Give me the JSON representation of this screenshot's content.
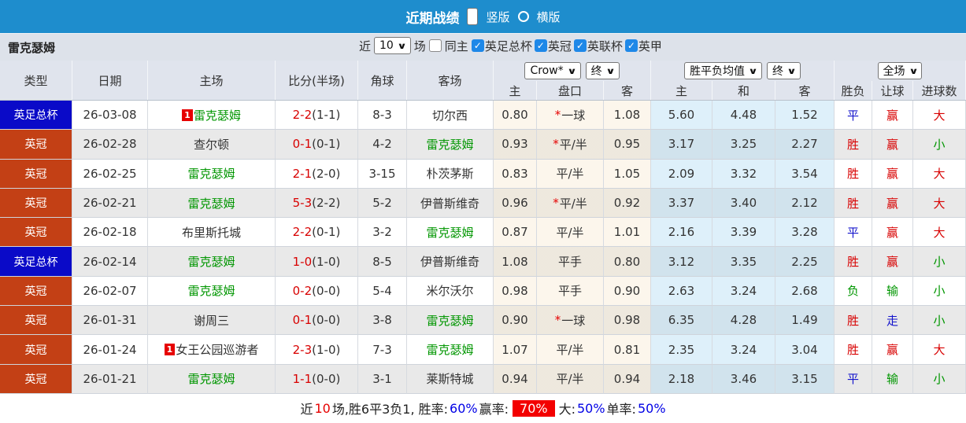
{
  "topbar": {
    "title": "近期战绩",
    "vertical_label": "竖版",
    "horizontal_label": "横版",
    "selected_layout": "竖版"
  },
  "filterbar": {
    "team": "雷克瑟姆",
    "recent_label": "近",
    "recent_value": "10",
    "games_label": "场",
    "same_venue_label": "同主",
    "leagues": [
      {
        "label": "英足总杯",
        "checked": true
      },
      {
        "label": "英冠",
        "checked": true
      },
      {
        "label": "英联杯",
        "checked": true
      },
      {
        "label": "英甲",
        "checked": true
      }
    ]
  },
  "header": {
    "columns": {
      "type": "类型",
      "date": "日期",
      "home": "主场",
      "score": "比分(半场)",
      "corner": "角球",
      "away": "客场",
      "odds_home": "主",
      "odds_line": "盘口",
      "odds_away": "客",
      "avg_home": "主",
      "avg_draw": "和",
      "avg_away": "客",
      "res_wdl": "胜负",
      "res_handicap": "让球",
      "res_goals": "进球数"
    },
    "selects": {
      "bookmaker": "Crow*",
      "odds_time": "终",
      "avg_name": "胜平负均值",
      "avg_time": "终",
      "scope": "全场"
    }
  },
  "colors": {
    "bar_blue": "#1e8dcd",
    "cup_blue": "#0a0ac8",
    "league_orange": "#c34015",
    "team_green": "#009600",
    "score_red": "#d80000",
    "win_red": "#d80000",
    "draw_blue": "#1414cc",
    "lose_green": "#009600",
    "badge_red": "#e60000"
  },
  "rows": [
    {
      "type": "英足总杯",
      "type_style": "cup",
      "date": "26-03-08",
      "home": {
        "badge": "1",
        "name": "雷克瑟姆",
        "green": true
      },
      "score": "2-2",
      "half": "(1-1)",
      "corner": "8-3",
      "away": {
        "name": "切尔西",
        "green": false
      },
      "odds": {
        "home": "0.80",
        "star": true,
        "line": "一球",
        "away": "1.08"
      },
      "avg": {
        "home": "5.60",
        "draw": "4.48",
        "away": "1.52"
      },
      "result": {
        "wdl": "平",
        "wdl_c": "blue",
        "handicap": "赢",
        "handicap_c": "red",
        "goals": "大",
        "goals_c": "red"
      }
    },
    {
      "type": "英冠",
      "type_style": "league",
      "date": "26-02-28",
      "home": {
        "name": "查尔顿",
        "green": false
      },
      "score": "0-1",
      "half": "(0-1)",
      "corner": "4-2",
      "away": {
        "name": "雷克瑟姆",
        "green": true
      },
      "odds": {
        "home": "0.93",
        "star": true,
        "line": "平/半",
        "away": "0.95"
      },
      "avg": {
        "home": "3.17",
        "draw": "3.25",
        "away": "2.27"
      },
      "result": {
        "wdl": "胜",
        "wdl_c": "red",
        "handicap": "赢",
        "handicap_c": "red",
        "goals": "小",
        "goals_c": "green"
      }
    },
    {
      "type": "英冠",
      "type_style": "league",
      "date": "26-02-25",
      "home": {
        "name": "雷克瑟姆",
        "green": true
      },
      "score": "2-1",
      "half": "(2-0)",
      "corner": "3-15",
      "away": {
        "name": "朴茨茅斯",
        "green": false
      },
      "odds": {
        "home": "0.83",
        "star": false,
        "line": "平/半",
        "away": "1.05"
      },
      "avg": {
        "home": "2.09",
        "draw": "3.32",
        "away": "3.54"
      },
      "result": {
        "wdl": "胜",
        "wdl_c": "red",
        "handicap": "赢",
        "handicap_c": "red",
        "goals": "大",
        "goals_c": "red"
      }
    },
    {
      "type": "英冠",
      "type_style": "league",
      "date": "26-02-21",
      "home": {
        "name": "雷克瑟姆",
        "green": true
      },
      "score": "5-3",
      "half": "(2-2)",
      "corner": "5-2",
      "away": {
        "name": "伊普斯维奇",
        "green": false
      },
      "odds": {
        "home": "0.96",
        "star": true,
        "line": "平/半",
        "away": "0.92"
      },
      "avg": {
        "home": "3.37",
        "draw": "3.40",
        "away": "2.12"
      },
      "result": {
        "wdl": "胜",
        "wdl_c": "red",
        "handicap": "赢",
        "handicap_c": "red",
        "goals": "大",
        "goals_c": "red"
      }
    },
    {
      "type": "英冠",
      "type_style": "league",
      "date": "26-02-18",
      "home": {
        "name": "布里斯托城",
        "green": false
      },
      "score": "2-2",
      "half": "(0-1)",
      "corner": "3-2",
      "away": {
        "name": "雷克瑟姆",
        "green": true
      },
      "odds": {
        "home": "0.87",
        "star": false,
        "line": "平/半",
        "away": "1.01"
      },
      "avg": {
        "home": "2.16",
        "draw": "3.39",
        "away": "3.28"
      },
      "result": {
        "wdl": "平",
        "wdl_c": "blue",
        "handicap": "赢",
        "handicap_c": "red",
        "goals": "大",
        "goals_c": "red"
      }
    },
    {
      "type": "英足总杯",
      "type_style": "cup",
      "date": "26-02-14",
      "home": {
        "name": "雷克瑟姆",
        "green": true
      },
      "score": "1-0",
      "half": "(1-0)",
      "corner": "8-5",
      "away": {
        "name": "伊普斯维奇",
        "green": false
      },
      "odds": {
        "home": "1.08",
        "star": false,
        "line": "平手",
        "away": "0.80"
      },
      "avg": {
        "home": "3.12",
        "draw": "3.35",
        "away": "2.25"
      },
      "result": {
        "wdl": "胜",
        "wdl_c": "red",
        "handicap": "赢",
        "handicap_c": "red",
        "goals": "小",
        "goals_c": "green"
      }
    },
    {
      "type": "英冠",
      "type_style": "league",
      "date": "26-02-07",
      "home": {
        "name": "雷克瑟姆",
        "green": true
      },
      "score": "0-2",
      "half": "(0-0)",
      "corner": "5-4",
      "away": {
        "name": "米尔沃尔",
        "green": false
      },
      "odds": {
        "home": "0.98",
        "star": false,
        "line": "平手",
        "away": "0.90"
      },
      "avg": {
        "home": "2.63",
        "draw": "3.24",
        "away": "2.68"
      },
      "result": {
        "wdl": "负",
        "wdl_c": "green",
        "handicap": "输",
        "handicap_c": "green",
        "goals": "小",
        "goals_c": "green"
      }
    },
    {
      "type": "英冠",
      "type_style": "league",
      "date": "26-01-31",
      "home": {
        "name": "谢周三",
        "green": false
      },
      "score": "0-1",
      "half": "(0-0)",
      "corner": "3-8",
      "away": {
        "name": "雷克瑟姆",
        "green": true
      },
      "odds": {
        "home": "0.90",
        "star": true,
        "line": "一球",
        "away": "0.98"
      },
      "avg": {
        "home": "6.35",
        "draw": "4.28",
        "away": "1.49"
      },
      "result": {
        "wdl": "胜",
        "wdl_c": "red",
        "handicap": "走",
        "handicap_c": "blue",
        "goals": "小",
        "goals_c": "green"
      }
    },
    {
      "type": "英冠",
      "type_style": "league",
      "date": "26-01-24",
      "home": {
        "badge": "1",
        "name": "女王公园巡游者",
        "green": false
      },
      "score": "2-3",
      "half": "(1-0)",
      "corner": "7-3",
      "away": {
        "name": "雷克瑟姆",
        "green": true
      },
      "odds": {
        "home": "1.07",
        "star": false,
        "line": "平/半",
        "away": "0.81"
      },
      "avg": {
        "home": "2.35",
        "draw": "3.24",
        "away": "3.04"
      },
      "result": {
        "wdl": "胜",
        "wdl_c": "red",
        "handicap": "赢",
        "handicap_c": "red",
        "goals": "大",
        "goals_c": "red"
      }
    },
    {
      "type": "英冠",
      "type_style": "league",
      "date": "26-01-21",
      "home": {
        "name": "雷克瑟姆",
        "green": true
      },
      "score": "1-1",
      "half": "(0-0)",
      "corner": "3-1",
      "away": {
        "name": "莱斯特城",
        "green": false
      },
      "odds": {
        "home": "0.94",
        "star": false,
        "line": "平/半",
        "away": "0.94"
      },
      "avg": {
        "home": "2.18",
        "draw": "3.46",
        "away": "3.15"
      },
      "result": {
        "wdl": "平",
        "wdl_c": "blue",
        "handicap": "输",
        "handicap_c": "green",
        "goals": "小",
        "goals_c": "green"
      }
    }
  ],
  "footer": {
    "parts": [
      {
        "text": "近",
        "style": "plain"
      },
      {
        "text": "10",
        "style": "red"
      },
      {
        "text": "场,胜6平3负1, 胜率:",
        "style": "plain"
      },
      {
        "text": "60%",
        "style": "blue"
      },
      {
        "text": " 赢率:",
        "style": "plain"
      },
      {
        "text": "70%",
        "style": "badge"
      },
      {
        "text": " 大:",
        "style": "plain"
      },
      {
        "text": "50%",
        "style": "blue"
      },
      {
        "text": " 单率:",
        "style": "plain"
      },
      {
        "text": "50%",
        "style": "blue"
      }
    ]
  }
}
